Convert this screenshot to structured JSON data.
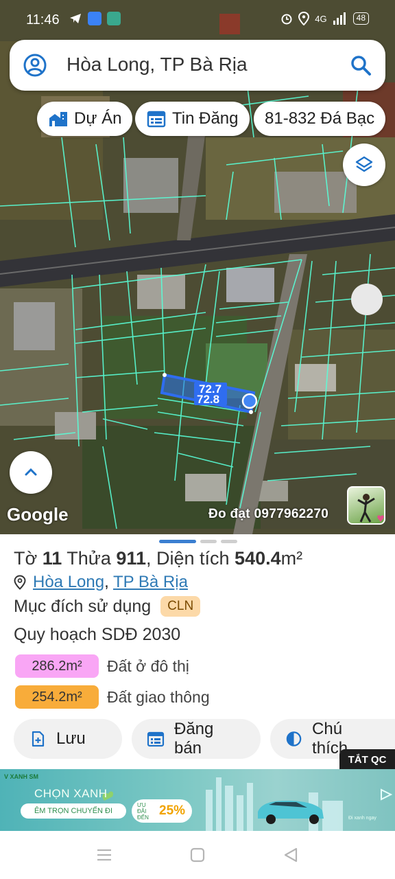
{
  "status_bar": {
    "time": "11:46",
    "network": "4G",
    "battery": "48"
  },
  "search": {
    "query": "Hòa Long, TP Bà Rịa"
  },
  "chips": [
    {
      "label": "Dự Án",
      "icon": "city-icon"
    },
    {
      "label": "Tin Đăng",
      "icon": "calendar-icon"
    },
    {
      "label": "81-832 Đá Bạc",
      "icon": ""
    }
  ],
  "map": {
    "parcel_label_top": "72.7",
    "parcel_label_bottom": "72.8",
    "provider": "Google",
    "credit": "Đo đạt 0977962270",
    "parcel_color": "#2f6df0",
    "boundary_color": "#59ffd8"
  },
  "parcel": {
    "title_prefix": "Tờ",
    "sheet_no": "11",
    "plot_prefix": "Thửa",
    "plot_no": "911",
    "area_prefix": ", Diện tích",
    "area": "540.4",
    "area_unit": "m²",
    "location_ward": "Hòa Long",
    "location_sep": ",",
    "location_city": "TP Bà Rịa",
    "purpose_label": "Mục đích sử dụng",
    "purpose_code": "CLN",
    "plan_label": "Quy hoạch SDĐ 2030",
    "zones": [
      {
        "amount": "286.2m²",
        "label": "Đất ở đô thị",
        "color": "#f9a6f5"
      },
      {
        "amount": "254.2m²",
        "label": "Đất giao thông",
        "color": "#f8ac3a"
      }
    ]
  },
  "actions": [
    {
      "label": "Lưu",
      "icon": "save-icon"
    },
    {
      "label": "Đăng bán",
      "icon": "post-icon"
    },
    {
      "label": "Chú thích",
      "icon": "legend-icon"
    }
  ],
  "ad": {
    "close_label": "TẮT QC",
    "headline": "CHỌN XANH",
    "sub": "ÊM TRỌN CHUYẾN ĐI",
    "promo_small": "ƯU ĐÃI ĐẾN",
    "promo_pct": "25%",
    "brand": "V XANH SM",
    "cta": "Đi xanh ngay"
  }
}
